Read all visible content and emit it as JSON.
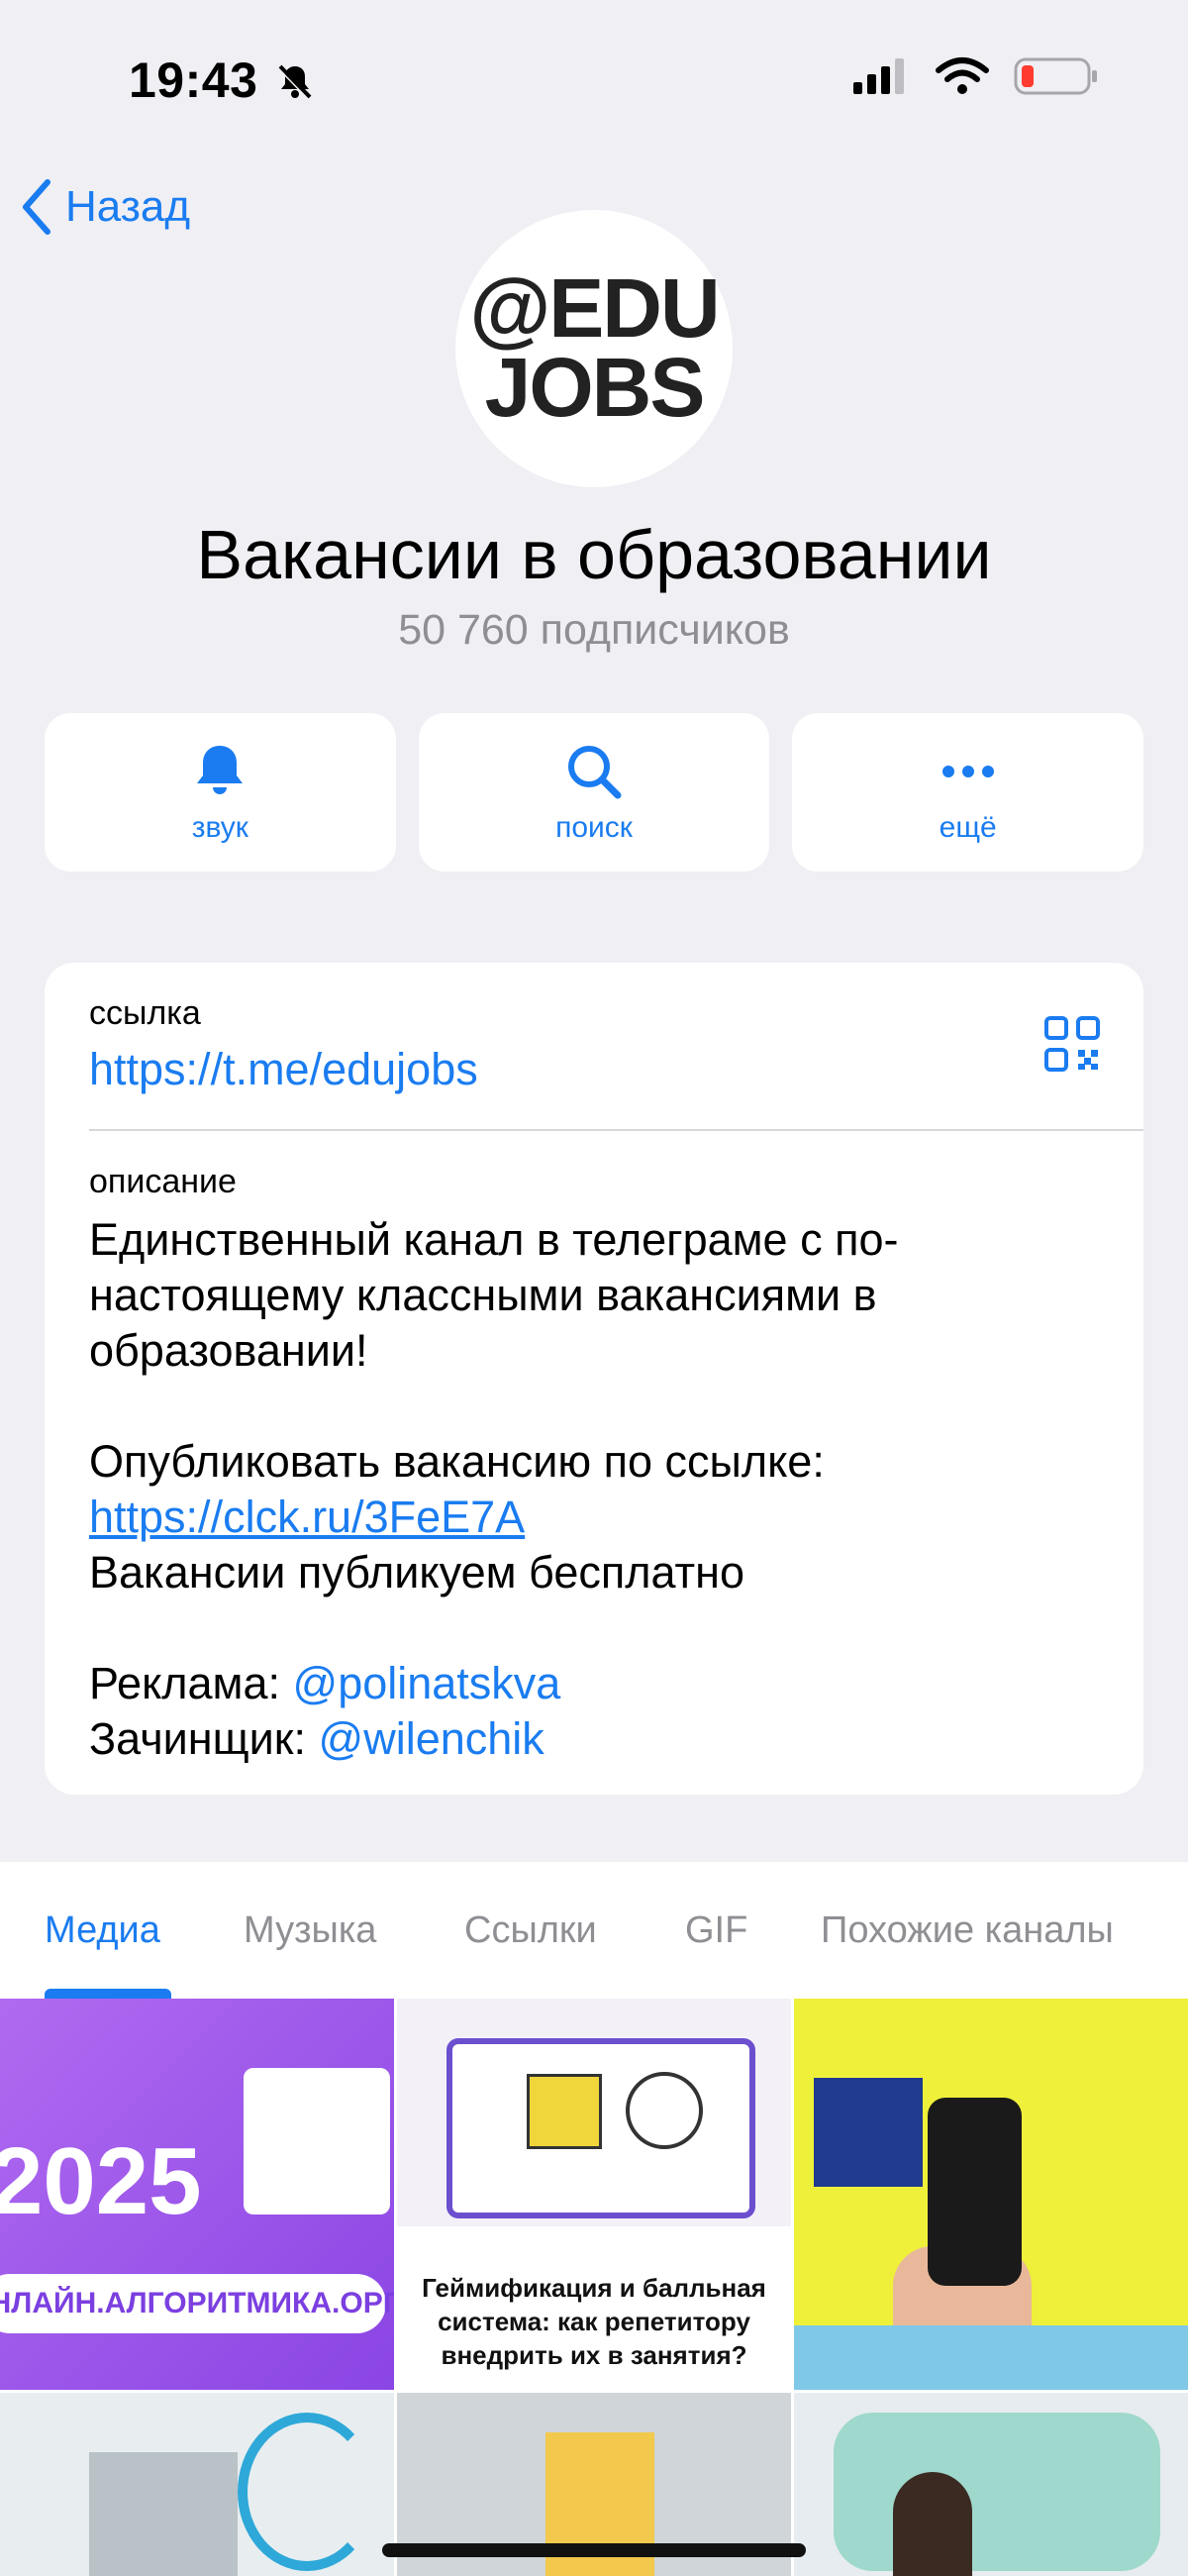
{
  "status_bar": {
    "time": "19:43"
  },
  "nav": {
    "back_label": "Назад"
  },
  "channel": {
    "avatar_line1": "@EDU",
    "avatar_line2": "JOBS",
    "title": "Вакансии в образовании",
    "subscribers": "50 760 подписчиков"
  },
  "actions": [
    {
      "label": "звук",
      "icon": "bell-icon"
    },
    {
      "label": "поиск",
      "icon": "search-icon"
    },
    {
      "label": "ещё",
      "icon": "more-icon"
    }
  ],
  "info": {
    "link_caption": "ссылка",
    "link_value": "https://t.me/edujobs",
    "description_caption": "описание",
    "description_p1": "Единственный канал в телеграме с по-настоящему классными вакансиями в образовании!",
    "publish_prefix": "Опубликовать вакансию по ссылке: ",
    "publish_link": "https://clck.ru/3FeE7A",
    "free_text": "Вакансии публикуем бесплатно",
    "ads_prefix": "Реклама: ",
    "ads_mention": "@polinatskva",
    "founder_prefix": "Зачинщик: ",
    "founder_mention": "@wilenchik"
  },
  "tabs": [
    "Медиа",
    "Музыка",
    "Ссылки",
    "GIF",
    "Похожие каналы"
  ],
  "media": {
    "tile1_year": "2025",
    "tile1_site": "ОНЛАЙН.АЛГОРИТМИКА.ОРГ",
    "tile2_caption": "Геймификация и балльная система: как репетитору внедрить их в занятия?"
  },
  "colors": {
    "accent": "#1a7cf0",
    "background": "#efeff4"
  }
}
